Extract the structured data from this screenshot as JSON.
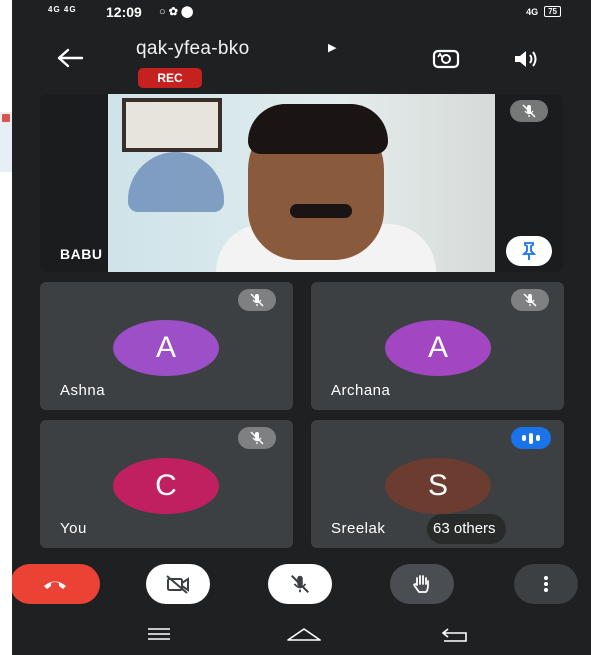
{
  "status_bar": {
    "signal_1": "4G",
    "signal_2": "4G",
    "time": "12:09",
    "icons": "○ ✿ ⬤",
    "right_signal": "4G",
    "battery": "75"
  },
  "header": {
    "meeting_code": "qak-yfea-bko",
    "rec_label": "REC"
  },
  "participants": {
    "main": {
      "name": "BABU"
    },
    "ashna": {
      "name": "Ashna",
      "initial": "A",
      "color": "#9c4fc7"
    },
    "archana": {
      "name": "Archana",
      "initial": "A",
      "color": "#a346c2"
    },
    "you": {
      "name": "You",
      "initial": "C",
      "color": "#c0205f"
    },
    "sreelak": {
      "name": "Sreelak",
      "initial": "S",
      "color": "#6b3c2f",
      "others": "63 others"
    }
  },
  "colors": {
    "end_call": "#ea4335",
    "background": "#1f2022",
    "tile": "#3c4043",
    "speaking": "#1a73e8"
  },
  "icons": [
    "back-arrow-icon",
    "camera-switch-icon",
    "speaker-icon",
    "mic-off-icon",
    "pin-icon",
    "end-call-icon",
    "video-off-icon",
    "raise-hand-icon",
    "more-icon",
    "nav-menu-icon",
    "nav-home-icon",
    "nav-back-icon"
  ]
}
